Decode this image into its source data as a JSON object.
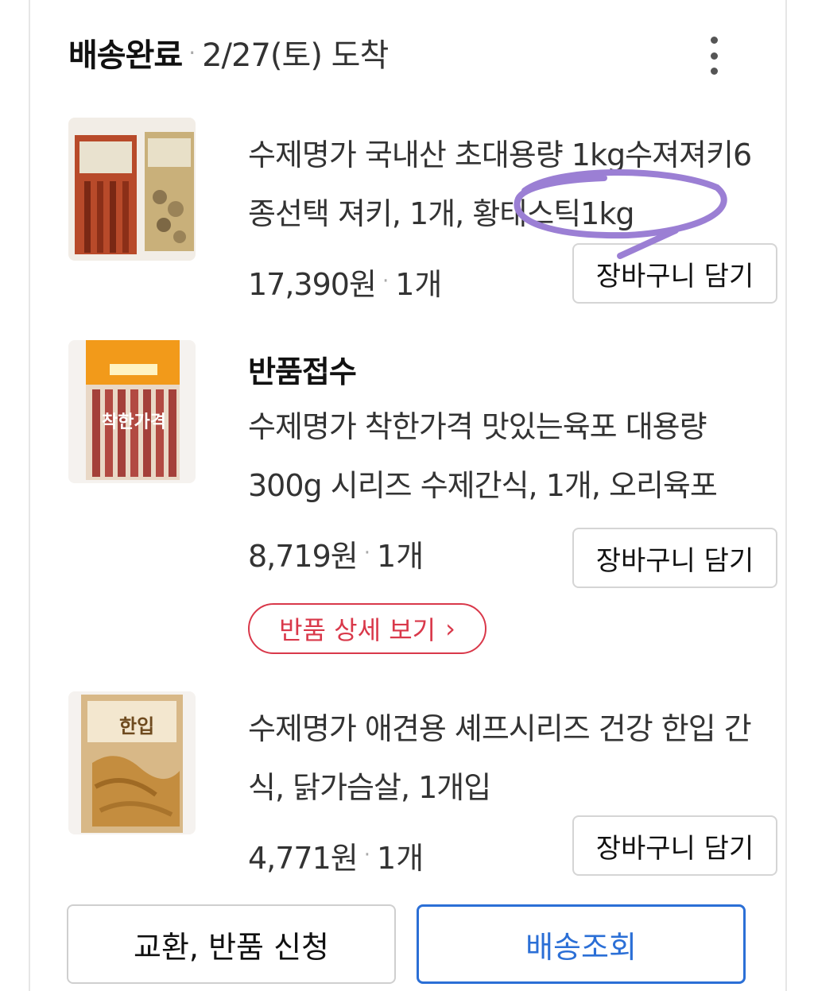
{
  "header": {
    "status": "배송완료",
    "date": "2/27(토) 도착"
  },
  "items": [
    {
      "title": "수제명가 국내산 초대용량 1kg수져져키6종선택 져키, 1개, 황태스틱1kg",
      "price": "17,390원",
      "qty": "1개",
      "cart_label": "장바구니 담기"
    },
    {
      "status": "반품접수",
      "title": "수제명가 착한가격 맛있는육포 대용량 300g 시리즈 수제간식, 1개, 오리육포",
      "price": "8,719원",
      "qty": "1개",
      "cart_label": "장바구니 담기",
      "return_detail_label": "반품 상세 보기"
    },
    {
      "title": "수제명가 애견용 셰프시리즈 건강 한입 간식, 닭가슴살, 1개입",
      "price": "4,771원",
      "qty": "1개",
      "cart_label": "장바구니 담기"
    }
  ],
  "thumbs": {
    "item2_text": "착한가격",
    "item3_text": "한입"
  },
  "actions": {
    "exchange_return": "교환, 반품 신청",
    "track_delivery": "배송조회"
  },
  "colors": {
    "accent_blue": "#2b6fd6",
    "return_red": "#d9384a",
    "annotation_purple": "#9b7fd4"
  }
}
